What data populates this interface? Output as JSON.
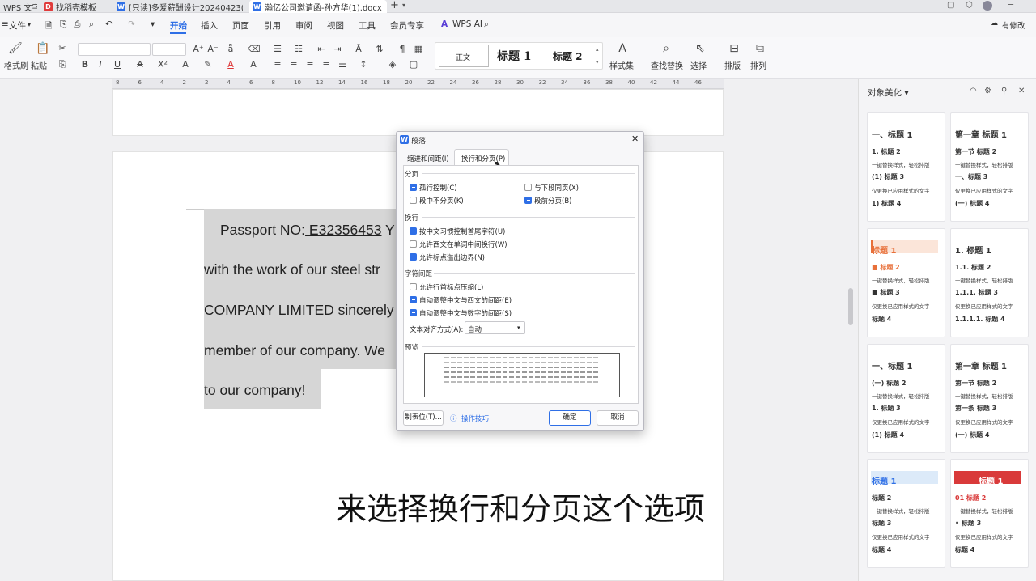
{
  "tabs": [
    {
      "label": "WPS 文字",
      "icon": "wps-logo-icon",
      "icon_char": "",
      "color": "#2f6fe6"
    },
    {
      "label": "找稻壳模板",
      "icon": "docer-icon",
      "icon_char": "D",
      "color": "#e03b3b"
    },
    {
      "label": "[只读]多爱薪酬设计20240423(3).dc",
      "icon": "word-doc-icon",
      "icon_char": "W",
      "color": "#2f6fe6"
    },
    {
      "label": "瀚亿公司邀请函-孙方华(1).docx",
      "icon": "word-doc-icon",
      "icon_char": "W",
      "color": "#2f6fe6"
    }
  ],
  "titlebar": {
    "new_tab": "+"
  },
  "menu": {
    "file": "文件",
    "items": [
      "开始",
      "插入",
      "页面",
      "引用",
      "审阅",
      "视图",
      "工具",
      "会员专享"
    ],
    "wps_ai": "WPS AI",
    "has_changes": "有修改"
  },
  "ribbon": {
    "format_painter": "格式刷",
    "paste": "粘贴",
    "styles": [
      "正文",
      "标题 1",
      "标题 2"
    ],
    "style_set": "样式集",
    "find_replace": "查找替换",
    "select": "选择",
    "arrange_layout": "排版",
    "arrange": "排列"
  },
  "ruler": {
    "marks": [
      "8",
      "6",
      "4",
      "2",
      "2",
      "4",
      "6",
      "8",
      "10",
      "12",
      "14",
      "16",
      "18",
      "20",
      "22",
      "24",
      "26",
      "28",
      "30",
      "32",
      "34",
      "36",
      "38",
      "40",
      "42",
      "44",
      "46"
    ]
  },
  "document": {
    "lines": [
      {
        "pre": "Passport NO:",
        "passport": " E32356453",
        "post": " Y"
      },
      {
        "text": "with the work of our steel str"
      },
      {
        "text": "COMPANY LIMITED sincerely"
      },
      {
        "text": "member of our company. We"
      },
      {
        "text": "to our company!"
      }
    ]
  },
  "subtitle": "来选择换行和分页这个选项",
  "dialog": {
    "title": "段落",
    "tabs": [
      "缩进和间距(I)",
      "换行和分页(P)"
    ],
    "sections": {
      "pagination": {
        "label": "分页",
        "options": [
          {
            "label": "孤行控制(C)",
            "checked": true
          },
          {
            "label": "与下段同页(X)",
            "checked": false
          },
          {
            "label": "段中不分页(K)",
            "checked": false
          },
          {
            "label": "段前分页(B)",
            "checked": true
          }
        ]
      },
      "line_break": {
        "label": "换行",
        "options": [
          {
            "label": "按中文习惯控制首尾字符(U)",
            "checked": true
          },
          {
            "label": "允许西文在单词中间换行(W)",
            "checked": false
          },
          {
            "label": "允许标点溢出边界(N)",
            "checked": true
          }
        ]
      },
      "char_spacing": {
        "label": "字符间距",
        "options": [
          {
            "label": "允许行首标点压缩(L)",
            "checked": false
          },
          {
            "label": "自动调整中文与西文的间距(E)",
            "checked": true
          },
          {
            "label": "自动调整中文与数字的间距(S)",
            "checked": true
          }
        ]
      }
    },
    "text_align": {
      "label": "文本对齐方式(A):",
      "value": "自动"
    },
    "preview_label": "预览",
    "buttons": {
      "tabs": "制表位(T)...",
      "tips": "操作技巧",
      "ok": "确定",
      "cancel": "取消"
    }
  },
  "right_panel": {
    "title": "对象美化",
    "cards": [
      {
        "lines": [
          "一、标题 1",
          "1. 标题 2",
          "一键替换样式，轻松排版",
          "(1) 标题 3",
          "仅更换已应用样式的文字",
          "1) 标题 4"
        ]
      },
      {
        "lines": [
          "第一章 标题 1",
          "第一节 标题 2",
          "一键替换样式，轻松排版",
          "一、标题 3",
          "仅更换已应用样式的文字",
          "(一) 标题 4"
        ]
      },
      {
        "lines": [
          "标题 1",
          "■ 标题 2",
          "一键替换样式，轻松排版",
          "■ 标题 3",
          "仅更换已应用样式的文字",
          "标题 4"
        ]
      },
      {
        "lines": [
          "1. 标题 1",
          "1.1. 标题 2",
          "一键替换样式，轻松排版",
          "1.1.1. 标题 3",
          "仅更换已应用样式的文字",
          "1.1.1.1. 标题 4"
        ]
      },
      {
        "lines": [
          "一、标题 1",
          "(一) 标题 2",
          "一键替换样式，轻松排版",
          "1. 标题 3",
          "仅更换已应用样式的文字",
          "(1) 标题 4"
        ]
      },
      {
        "lines": [
          "第一章  标题 1",
          "第一节  标题 2",
          "一键替换样式，轻松排版",
          "第一条  标题 3",
          "仅更换已应用样式的文字",
          "(一) 标题 4"
        ]
      },
      {
        "lines": [
          "标题 1",
          "标题 2",
          "一键替换样式，轻松排版",
          "标题 3",
          "仅更换已应用样式的文字",
          "标题 4"
        ]
      },
      {
        "lines": [
          "标题 1",
          "01 标题 2",
          "一键替换样式，轻松排版",
          "• 标题 3",
          "仅更换已应用样式的文字",
          "标题 4"
        ]
      }
    ]
  },
  "colors": {
    "accent": "#2f6fe6",
    "selection": "#d6d6d6",
    "style_orange": "#e8703a",
    "style_red": "#d93a3a",
    "style_blue_bg": "#dceaf9"
  }
}
